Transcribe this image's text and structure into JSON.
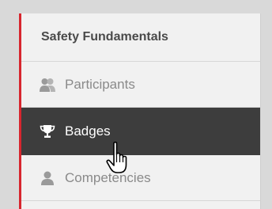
{
  "colors": {
    "accent": "#d7262e",
    "active_bg": "#3d3d3d",
    "icon_gray": "#9a9a9a"
  },
  "sidebar": {
    "heading": "Safety Fundamentals",
    "items": [
      {
        "label": "Participants",
        "icon": "participants-icon",
        "active": false
      },
      {
        "label": "Badges",
        "icon": "trophy-icon",
        "active": true
      },
      {
        "label": "Competencies",
        "icon": "person-icon",
        "active": false
      }
    ]
  },
  "cursor": {
    "type": "hand-pointer"
  }
}
